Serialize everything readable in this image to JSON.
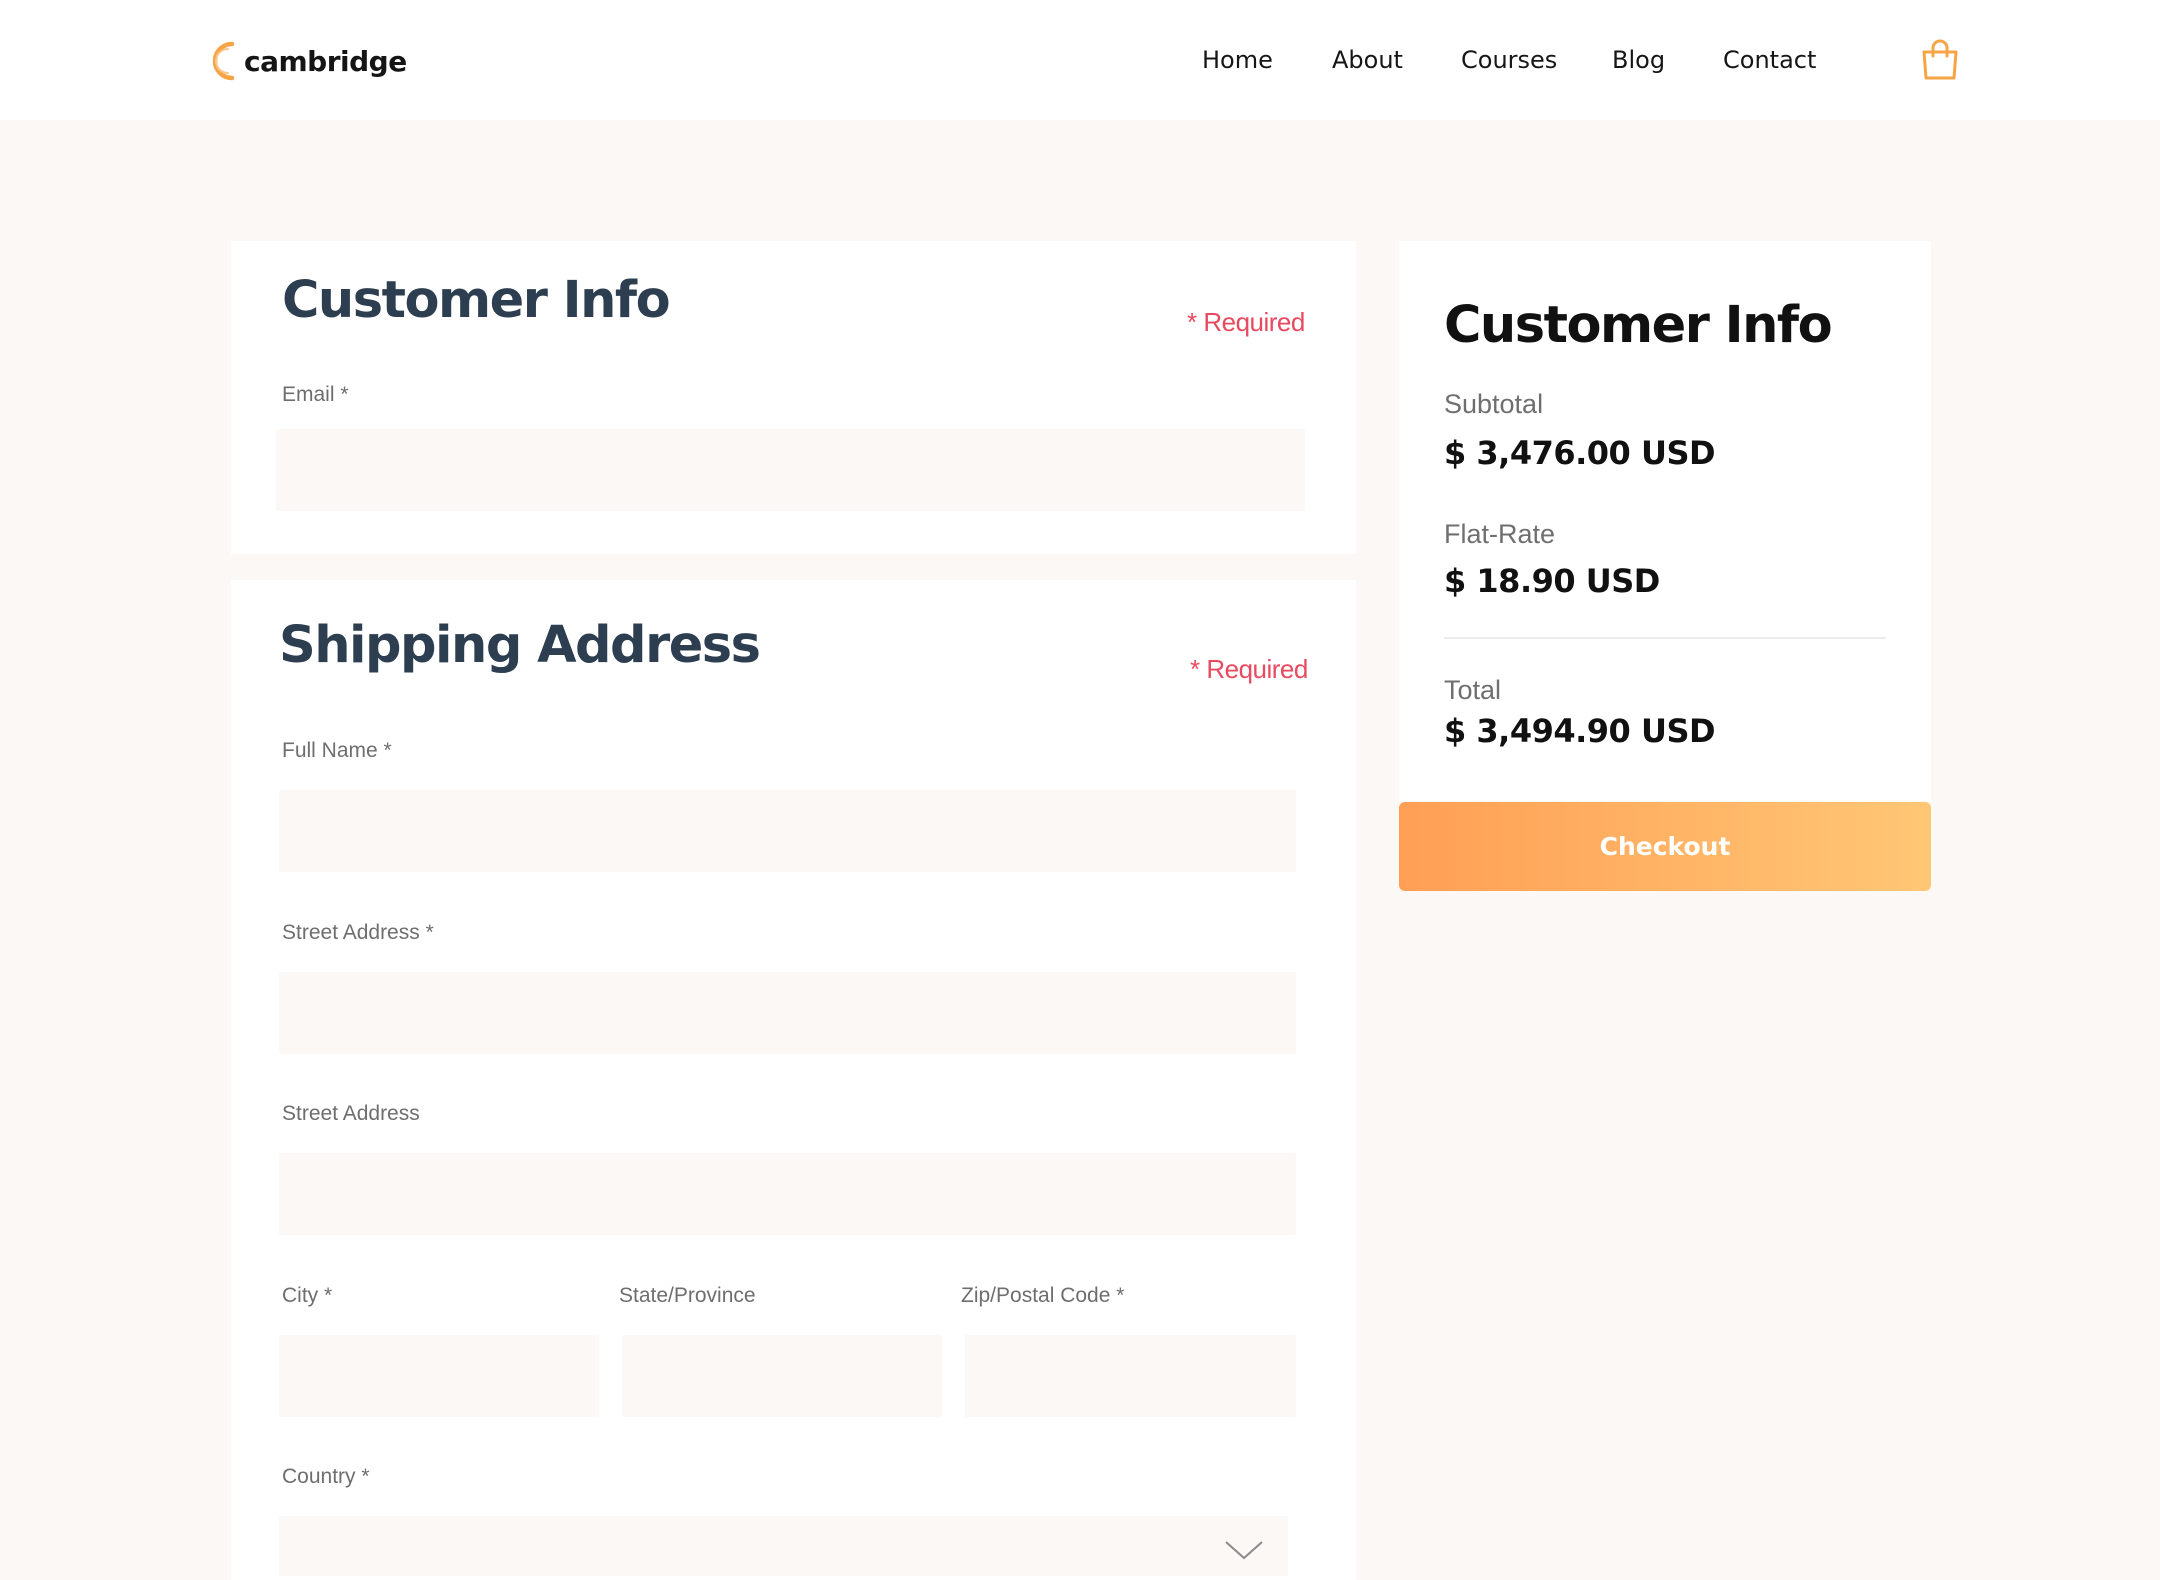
{
  "brand": {
    "name": "cambridge",
    "accent": "#f6a445"
  },
  "nav": {
    "items": [
      {
        "label": "Home"
      },
      {
        "label": "About"
      },
      {
        "label": "Courses"
      },
      {
        "label": "Blog"
      },
      {
        "label": "Contact"
      }
    ],
    "cart_icon": "shopping-bag-icon"
  },
  "customer_info": {
    "title": "Customer Info",
    "required_note": "* Required",
    "email": {
      "label": "Email *",
      "value": ""
    }
  },
  "shipping": {
    "title": "Shipping Address",
    "required_note": "* Required",
    "full_name": {
      "label": "Full Name *",
      "value": ""
    },
    "street1": {
      "label": "Street Address *",
      "value": ""
    },
    "street2": {
      "label": "Street Address",
      "value": ""
    },
    "city": {
      "label": "City *",
      "value": ""
    },
    "state": {
      "label": "State/Province",
      "value": ""
    },
    "zip": {
      "label": "Zip/Postal Code *",
      "value": ""
    },
    "country": {
      "label": "Country *",
      "value": "",
      "icon": "chevron-down-icon"
    }
  },
  "summary": {
    "title": "Customer Info",
    "subtotal_label": "Subtotal",
    "subtotal_value": "$ 3,476.00 USD",
    "shipping_label": "Flat-Rate",
    "shipping_value": "$ 18.90 USD",
    "total_label": "Total",
    "total_value": "$ 3,494.90 USD",
    "checkout_label": "Checkout"
  },
  "colors": {
    "page_bg": "#fcf8f5",
    "card_bg": "#ffffff",
    "heading": "#2c3e50",
    "required": "#e84a5f",
    "button_gradient_start": "#ff9f55",
    "button_gradient_end": "#ffc775"
  }
}
